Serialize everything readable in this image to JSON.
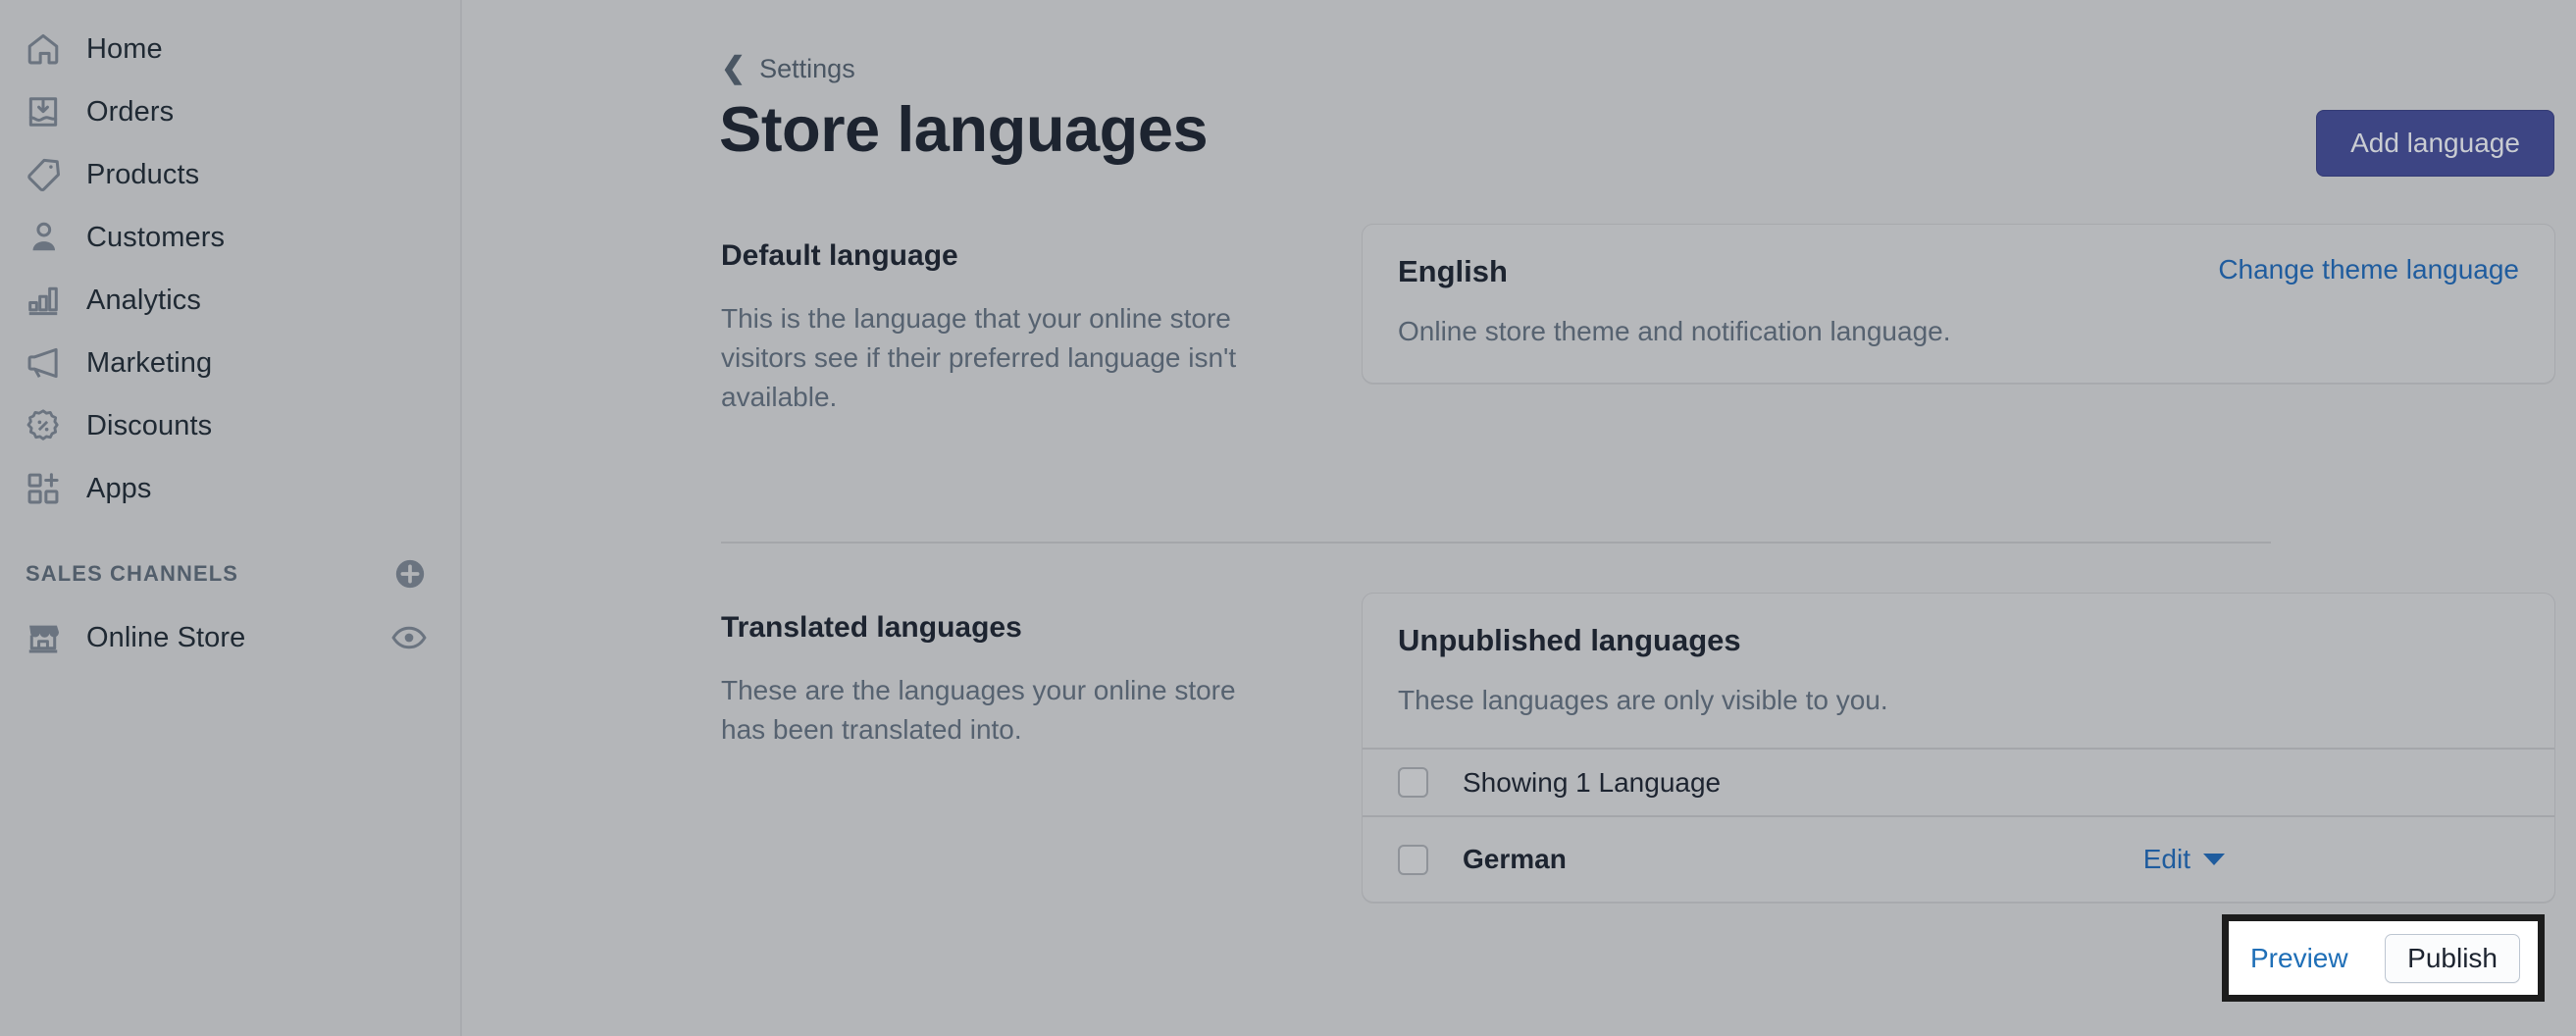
{
  "sidebar": {
    "nav_items": [
      {
        "label": "Home",
        "icon": "home-icon"
      },
      {
        "label": "Orders",
        "icon": "orders-icon"
      },
      {
        "label": "Products",
        "icon": "tag-icon"
      },
      {
        "label": "Customers",
        "icon": "person-icon"
      },
      {
        "label": "Analytics",
        "icon": "bar-chart-icon"
      },
      {
        "label": "Marketing",
        "icon": "megaphone-icon"
      },
      {
        "label": "Discounts",
        "icon": "discount-icon"
      },
      {
        "label": "Apps",
        "icon": "apps-icon"
      }
    ],
    "channels_title": "SALES CHANNELS",
    "add_channel_icon": "plus-circle-icon",
    "channels": [
      {
        "label": "Online Store",
        "icon": "storefront-icon",
        "trailing_icon": "eye-icon"
      }
    ]
  },
  "header": {
    "breadcrumb_label": "Settings",
    "back_icon": "chevron-left-icon",
    "title": "Store languages",
    "primary_action": "Add language"
  },
  "sections": [
    {
      "heading": "Default language",
      "description": "This is the language that your online store visitors see if their preferred language isn't available.",
      "card": {
        "title": "English",
        "action_label": "Change theme language",
        "subtitle": "Online store theme and notification language."
      }
    },
    {
      "heading": "Translated languages",
      "description": "These are the languages your online store has been translated into.",
      "card": {
        "title": "Unpublished languages",
        "subtitle": "These languages are only visible to you.",
        "rows": [
          {
            "label": "Showing 1 Language",
            "checked": false
          },
          {
            "label": "German",
            "checked": false,
            "edit_label": "Edit"
          }
        ]
      }
    }
  ],
  "highlight": {
    "preview_label": "Preview",
    "publish_label": "Publish"
  },
  "colors": {
    "accent_blue": "#1f5c9e",
    "primary_button": "#3d4584",
    "page_bg": "#b4b6b9",
    "highlight_border": "#1c1c1c"
  }
}
